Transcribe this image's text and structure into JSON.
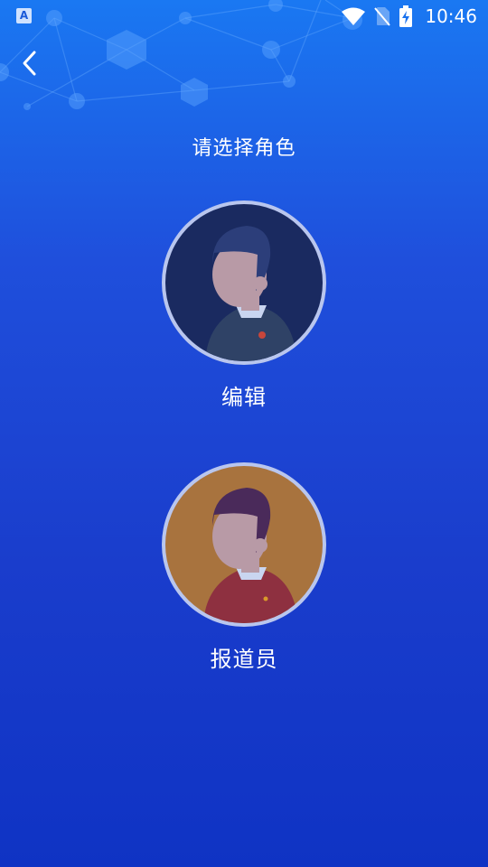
{
  "status_bar": {
    "app_icon_letter": "A",
    "time": "10:46",
    "icons": [
      "wifi-icon",
      "no-sim-icon",
      "battery-charging-icon"
    ]
  },
  "header": {
    "back_icon": "chevron-left-icon",
    "title": "请选择角色"
  },
  "roles": [
    {
      "label": "编辑",
      "avatar_bg": "#1a2a60",
      "shirt": "#2f4266",
      "hair": "#2c3e7a"
    },
    {
      "label": "报道员",
      "avatar_bg": "#a8733e",
      "shirt": "#8e3040",
      "hair": "#4a2a5a"
    }
  ],
  "colors": {
    "bg_top": "#1a78f2",
    "bg_bottom": "#0f33c4",
    "avatar_ring": "#b9c6ee",
    "face": "#b89aa6"
  }
}
